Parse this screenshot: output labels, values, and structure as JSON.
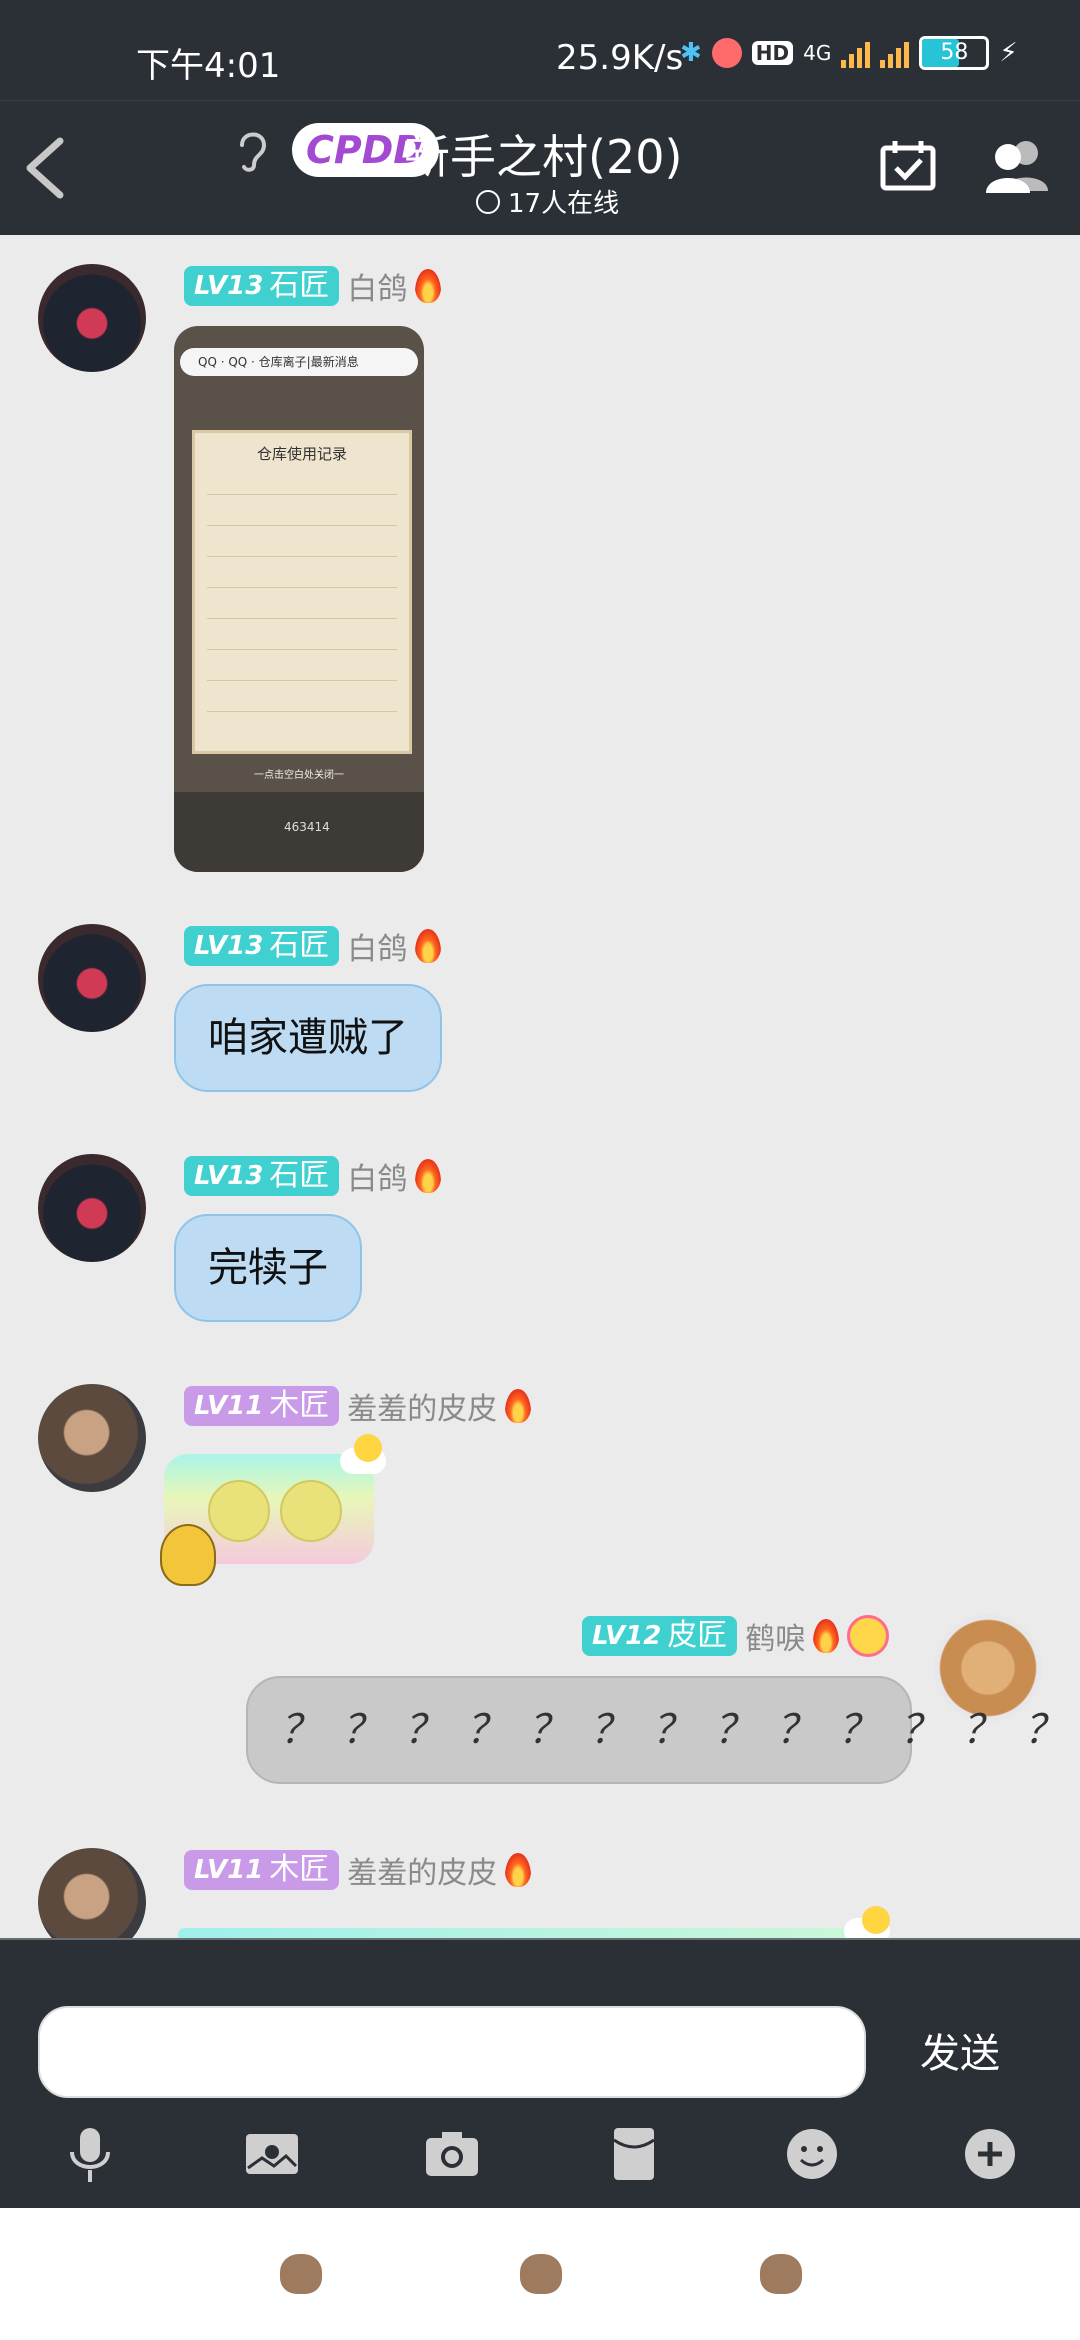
{
  "status_bar": {
    "time": "下午4:01",
    "net_speed": "25.9K/s",
    "hd_badge": "HD",
    "network_type": "4G",
    "battery_level": "58",
    "battery_fill": 0.58
  },
  "header": {
    "group_logo": "CPDD",
    "group_name": "新手之村(20)",
    "online_text": "17人在线"
  },
  "messages": [
    {
      "sender_level": "LV13",
      "sender_rank": "石匠",
      "sender_name": "白鸽",
      "type": "image",
      "image": {
        "search_bar_text": "QQ · QQ · 仓库离子|最新消息",
        "card_title": "仓库使用记录",
        "footer_text": "一点击空白处关闭一",
        "code": "463414"
      }
    },
    {
      "sender_level": "LV13",
      "sender_rank": "石匠",
      "sender_name": "白鸽",
      "type": "text",
      "text": "咱家遭贼了"
    },
    {
      "sender_level": "LV13",
      "sender_rank": "石匠",
      "sender_name": "白鸽",
      "type": "text",
      "text": "完犊子"
    },
    {
      "sender_level": "LV11",
      "sender_rank": "木匠",
      "sender_name": "羞羞的皮皮",
      "type": "sticker"
    },
    {
      "sender_level": "LV12",
      "sender_rank": "皮匠",
      "sender_name": "鹤唳",
      "type": "text",
      "outgoing": true,
      "text": "？？？？？？？？？？？？？"
    },
    {
      "sender_level": "LV11",
      "sender_rank": "木匠",
      "sender_name": "羞羞的皮皮",
      "type": "sticker"
    }
  ],
  "input": {
    "placeholder": "",
    "send_label": "发送"
  },
  "toolbar_icons": [
    "microphone-icon",
    "image-icon",
    "camera-icon",
    "red-packet-icon",
    "emoji-icon",
    "plus-icon"
  ],
  "colors": {
    "header_bg": "#2b2f36",
    "bubble_blue": "#bddcf3",
    "level_cyan": "#3fd0cf",
    "level_purple": "#c89ae8"
  }
}
